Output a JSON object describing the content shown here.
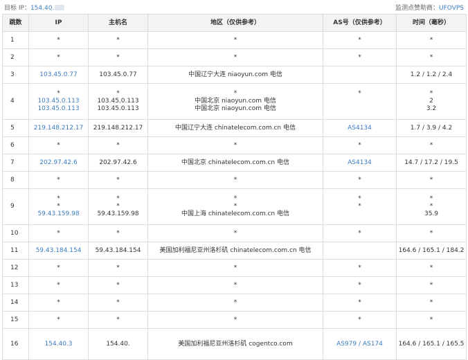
{
  "header": {
    "target_label": "目标 IP：",
    "target_value": "154.40.",
    "sponsor_label": "监测点赞助商：",
    "sponsor_value": "UFOVPS"
  },
  "columns": [
    "跳数",
    "IP",
    "主机名",
    "地区（仅供参考）",
    "AS号（仅供参考）",
    "时间（毫秒）"
  ],
  "rows": [
    {
      "hop": "1",
      "ip": [
        "*"
      ],
      "host": [
        "*"
      ],
      "region": [
        "*"
      ],
      "as": [
        "*"
      ],
      "time": [
        "*"
      ]
    },
    {
      "hop": "2",
      "ip": [
        "*"
      ],
      "host": [
        "*"
      ],
      "region": [
        "*"
      ],
      "as": [
        "*"
      ],
      "time": [
        "*"
      ]
    },
    {
      "hop": "3",
      "ip": [
        "103.45.0.77"
      ],
      "host": [
        "103.45.0.77"
      ],
      "region": [
        "中国辽宁大连 niaoyun.com 电信"
      ],
      "as": [
        ""
      ],
      "time": [
        "1.2 / 1.2 / 2.4"
      ]
    },
    {
      "hop": "4",
      "ip": [
        "*",
        "103.45.0.113",
        "103.45.0.113"
      ],
      "host": [
        "*",
        "103.45.0.113",
        "103.45.0.113"
      ],
      "region": [
        "*",
        "中国北京 niaoyun.com 电信",
        "中国北京 niaoyun.com 电信"
      ],
      "as": [
        "*",
        "",
        ""
      ],
      "time": [
        "*",
        "2",
        "3.2"
      ]
    },
    {
      "hop": "5",
      "ip": [
        "219.148.212.17"
      ],
      "host": [
        "219.148.212.17"
      ],
      "region": [
        "中国辽宁大连 chinatelecom.com.cn 电信"
      ],
      "as": [
        "AS4134"
      ],
      "time": [
        "1.7 / 3.9 / 4.2"
      ]
    },
    {
      "hop": "6",
      "ip": [
        "*"
      ],
      "host": [
        "*"
      ],
      "region": [
        "*"
      ],
      "as": [
        "*"
      ],
      "time": [
        "*"
      ]
    },
    {
      "hop": "7",
      "ip": [
        "202.97.42.6"
      ],
      "host": [
        "202.97.42.6"
      ],
      "region": [
        "中国北京 chinatelecom.com.cn 电信"
      ],
      "as": [
        "AS4134"
      ],
      "time": [
        "14.7 / 17.2 / 19.5"
      ]
    },
    {
      "hop": "8",
      "ip": [
        "*"
      ],
      "host": [
        "*"
      ],
      "region": [
        "*"
      ],
      "as": [
        "*"
      ],
      "time": [
        "*"
      ]
    },
    {
      "hop": "9",
      "ip": [
        "*",
        "*",
        "59.43.159.98"
      ],
      "host": [
        "*",
        "*",
        "59.43.159.98"
      ],
      "region": [
        "*",
        "*",
        "中国上海 chinatelecom.com.cn 电信"
      ],
      "as": [
        "*",
        "*",
        ""
      ],
      "time": [
        "*",
        "*",
        "35.9"
      ]
    },
    {
      "hop": "10",
      "ip": [
        "*"
      ],
      "host": [
        "*"
      ],
      "region": [
        "*"
      ],
      "as": [
        "*"
      ],
      "time": [
        "*"
      ]
    },
    {
      "hop": "11",
      "ip": [
        "59.43.184.154"
      ],
      "host": [
        "59.43.184.154"
      ],
      "region": [
        "美国加利福尼亚州洛杉矶 chinatelecom.com.cn 电信"
      ],
      "as": [
        ""
      ],
      "time": [
        "164.6 / 165.1 / 184.2"
      ]
    },
    {
      "hop": "12",
      "ip": [
        "*"
      ],
      "host": [
        "*"
      ],
      "region": [
        "*"
      ],
      "as": [
        "*"
      ],
      "time": [
        "*"
      ]
    },
    {
      "hop": "13",
      "ip": [
        "*"
      ],
      "host": [
        "*"
      ],
      "region": [
        "*"
      ],
      "as": [
        "*"
      ],
      "time": [
        "*"
      ]
    },
    {
      "hop": "14",
      "ip": [
        "*"
      ],
      "host": [
        "*"
      ],
      "region": [
        "*"
      ],
      "as": [
        "*"
      ],
      "time": [
        "*"
      ]
    },
    {
      "hop": "15",
      "ip": [
        "*"
      ],
      "host": [
        "*"
      ],
      "region": [
        "*"
      ],
      "as": [
        "*"
      ],
      "time": [
        "*"
      ]
    },
    {
      "hop": "16",
      "ip": [
        "154.40.3"
      ],
      "host": [
        "154.40."
      ],
      "region": [
        "美国加利福尼亚州洛杉矶 cogentco.com"
      ],
      "as": [
        "AS979 / AS174"
      ],
      "time": [
        "164.6 / 165.1 / 165.5"
      ]
    }
  ]
}
